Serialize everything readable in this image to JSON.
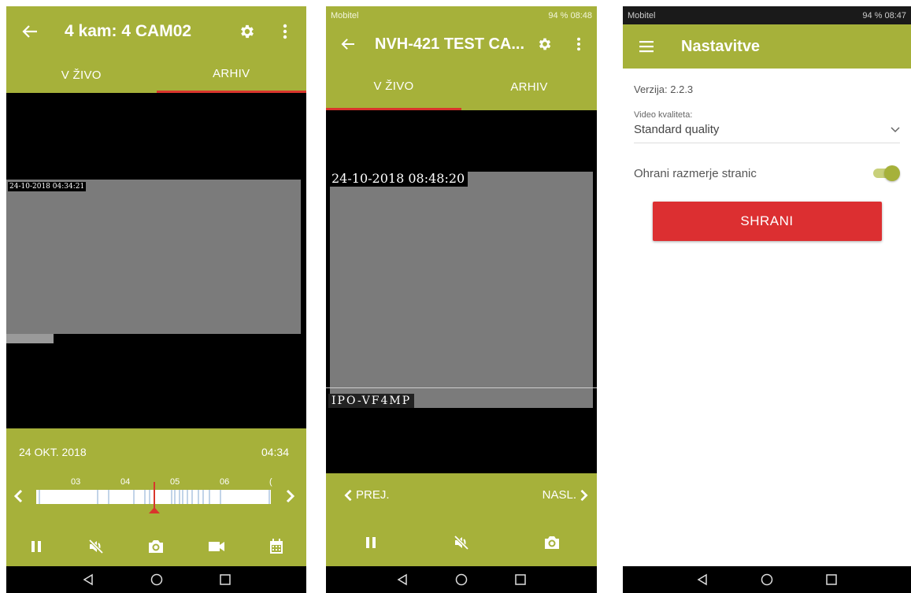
{
  "screen1": {
    "title": "4 kam: 4 CAM02",
    "tabs": [
      {
        "label": "V ŽIVO",
        "active": false
      },
      {
        "label": "ARHIV",
        "active": true
      }
    ],
    "osd_timestamp": "24-10-2018 04:34:21",
    "date": "24 OKT. 2018",
    "time": "04:34",
    "timeline_ticks": [
      "03",
      "04",
      "05",
      "06",
      "("
    ],
    "controls": [
      "pause-icon",
      "mute-icon",
      "camera-icon",
      "video-icon",
      "calendar-icon"
    ]
  },
  "screen2": {
    "status_carrier": "Mobitel",
    "status_right": "94 % 08:48",
    "title": "NVH-421 TEST CA...",
    "tabs": [
      {
        "label": "V ŽIVO",
        "active": true
      },
      {
        "label": "ARHIV",
        "active": false
      }
    ],
    "osd_timestamp": "24-10-2018 08:48:20",
    "osd_name": "IPO-VF4MP",
    "prev_label": "PREJ.",
    "next_label": "NASL.",
    "controls": [
      "pause-icon",
      "mute-icon",
      "camera-icon"
    ]
  },
  "screen3": {
    "status_carrier": "Mobitel",
    "status_right": "94 % 08:47",
    "title": "Nastavitve",
    "version": "Verzija: 2.2.3",
    "quality_label": "Video kvaliteta:",
    "quality_value": "Standard quality",
    "aspect_label": "Ohrani razmerje stranic",
    "aspect_enabled": true,
    "save_label": "SHRANI"
  },
  "colors": {
    "accent": "#a6b13a",
    "tab_indicator": "#d9352c",
    "save_button": "#dc2f31"
  }
}
